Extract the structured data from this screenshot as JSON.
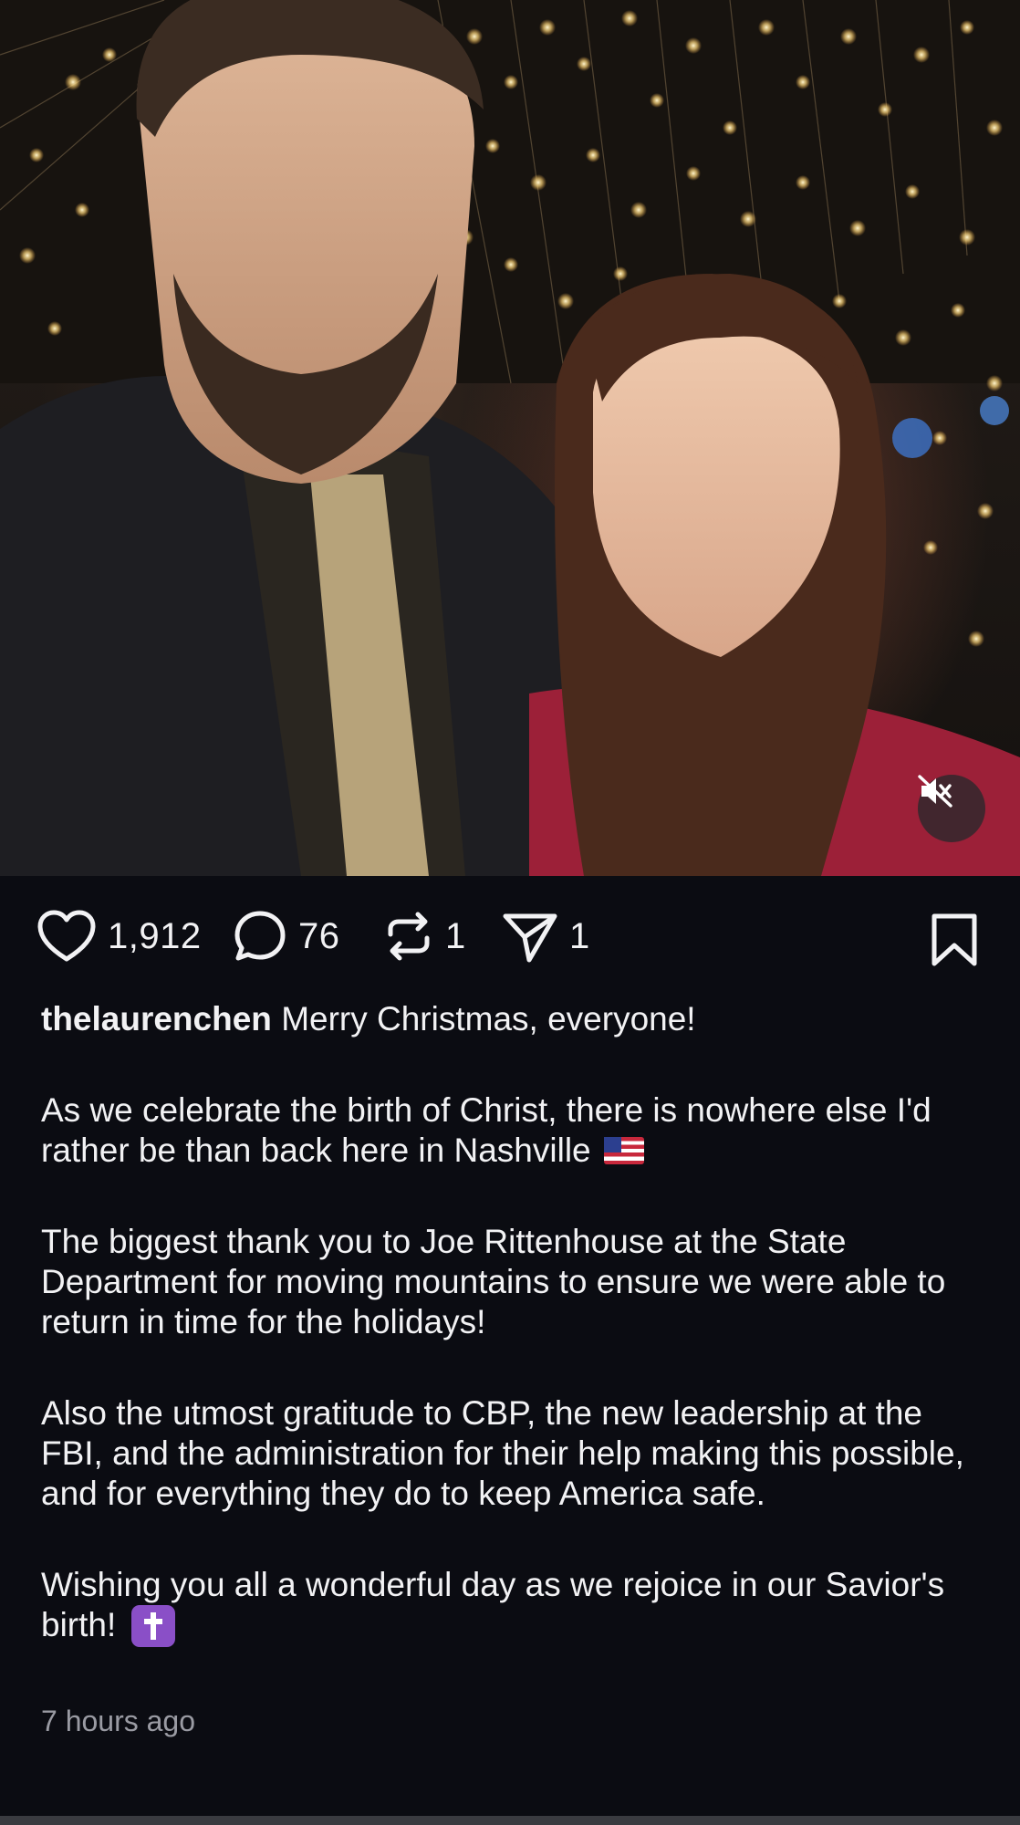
{
  "post": {
    "media": {
      "description_icon": "mute-icon"
    },
    "actions": {
      "likes": "1,912",
      "comments": "76",
      "reposts": "1",
      "shares": "1"
    },
    "caption": {
      "username": "thelaurenchen",
      "first_line": "Merry Christmas, everyone!",
      "para1": "As we celebrate the birth of Christ, there is nowhere else I'd rather be than back here in Nashville",
      "para2": "The biggest thank you to Joe Rittenhouse at the State Department for moving mountains to ensure we were able to return in time for the holidays!",
      "para3": "Also the utmost gratitude to CBP, the new leadership at the FBI, and the administration for their help making this possible, and for everything they do to keep America safe.",
      "para4": "Wishing you all a wonderful day as we rejoice in our Savior's birth!"
    },
    "timestamp": "7 hours ago"
  },
  "colors": {
    "background": "#0b0c12",
    "text": "#f2f2f4",
    "muted_text": "#9a9ba3"
  }
}
